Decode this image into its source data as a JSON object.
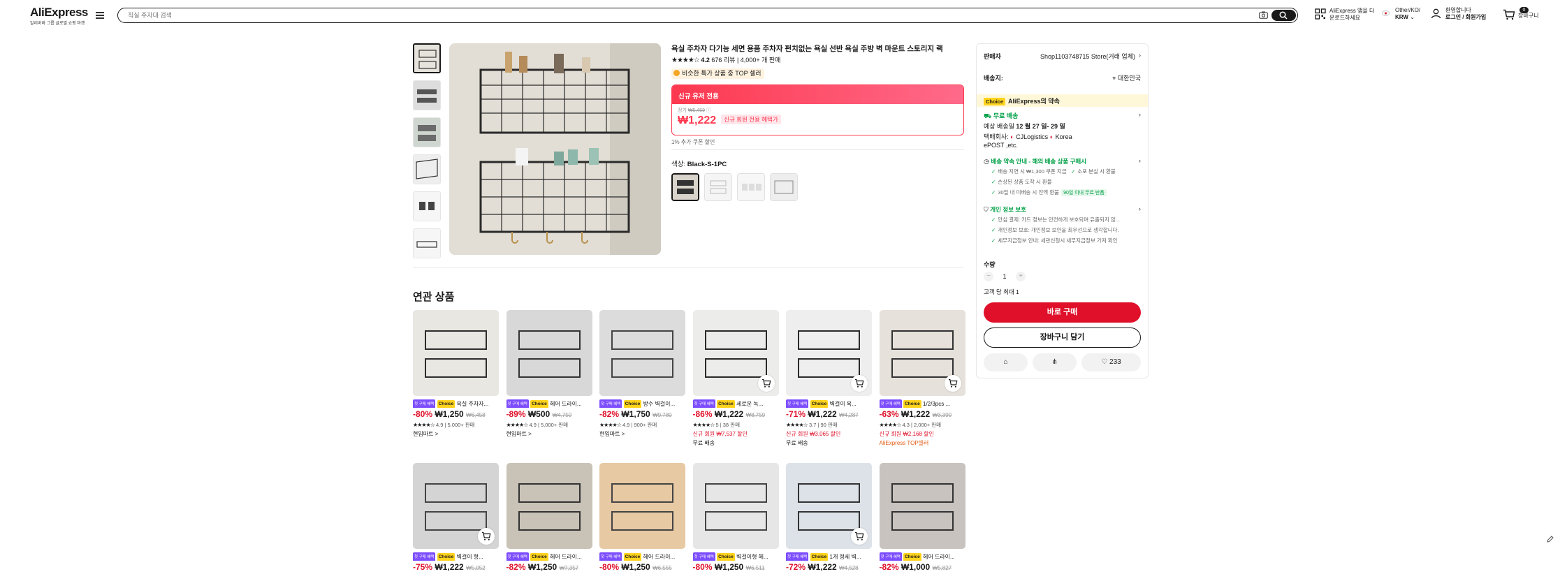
{
  "header": {
    "logo": "AliExpress",
    "logo_sub": "알리바바 그룹 글로벌 쇼핑 마켓",
    "search_placeholder": "직실 주자대 검색",
    "app_line1": "AliExpress 앱을 다",
    "app_line2": "운로드하세요",
    "lang_line1": "Other/KO/",
    "lang_line2": "KRW",
    "user_line1": "환영합니다",
    "user_line2": "로그인 / 회원가입",
    "cart_count": "0",
    "cart_label": "장바구니"
  },
  "product": {
    "title": "욕실 주차자 다기능 세면 용품 주차자 펀치없는 욕실 선반 욕실 주방 벽 마운트 스토리지 랙",
    "rating": "4.2",
    "reviews": "676 리뷰",
    "sold": "4,000+ 개 판매",
    "top_seller": "비슷한 특가 상품 중 TOP 셀러",
    "price_box_title": "신규 유저 전용",
    "orig_label": "정가",
    "orig_price": "₩5,459",
    "price": "₩1,222",
    "price_tag": "신규 회원 전용 혜택가",
    "coupon_note": "1% 추가 쿠폰 할인",
    "color_label": "색상:",
    "color_value": "Black-S-1PC"
  },
  "panel": {
    "seller_label": "판매자",
    "seller_value": "Shop1103748715 Store(거래 업체)",
    "ship_to_label": "배송지:",
    "ship_to_value": "대한민국",
    "choice_badge": "Choice",
    "choice_text": "AliExpress의 약속",
    "free_ship": "무료 배송",
    "delivery_label": "예상 배송일",
    "delivery_value": "12 월 27 일- 29 일",
    "carrier_label": "택배회사:",
    "carrier_value": "CJLogistics",
    "carrier_value2": "Korea",
    "carrier_value3": "ePOST ,etc.",
    "promise_title": "배송 약속 안내 - 해외 배송 상품 구매시",
    "promise_1": "배송 지연 시 ₩1,300 쿠폰 지급",
    "promise_1b": "소포 분실 시 환불",
    "promise_2": "손상된 상품 도착 시 환불",
    "promise_3": "30일 내 미배송 시 전액 환불",
    "promise_3_tag": "90일 이내 무료 반품",
    "privacy_title": "개인 정보 보호",
    "privacy_1": "안심 결제: 카드 정보는 안전하게 보호되며 유출되지 않...",
    "privacy_2": "개인정보 보호: 개인정보 보안을 최우선으로 생각합니다.",
    "privacy_3": "세무지급정보 안내: 세관신청시 세무지급정보 가져 확인",
    "qty_label": "수량",
    "qty_value": "1",
    "per_customer": "고객 당 최대 1",
    "buy_now": "바로 구매",
    "add_cart": "장바구니 담기",
    "wishlist_count": "233"
  },
  "related": {
    "title": "연관 상품",
    "new_tag": "첫 구매 혜택",
    "choice_tag": "Choice",
    "items": [
      {
        "name": "욕실 주차자...",
        "disc": "-80%",
        "price": "₩1,250",
        "orig": "₩6,458",
        "rating": "4.9",
        "meta": "5,000+ 판매",
        "extra": "현임마트 >",
        "extra_class": ""
      },
      {
        "name": "헤어 드라이...",
        "disc": "-89%",
        "price": "₩500",
        "orig": "₩4,750",
        "rating": "4.9",
        "meta": "5,000+ 판매",
        "extra": "현임마트 >",
        "extra_class": ""
      },
      {
        "name": "방수 벽걸이...",
        "disc": "-82%",
        "price": "₩1,750",
        "orig": "₩9,780",
        "rating": "4.9",
        "meta": "900+ 판매",
        "extra": "현임마트 >",
        "extra_class": ""
      },
      {
        "name": "세로운 녹...",
        "disc": "-86%",
        "price": "₩1,222",
        "orig": "₩8,759",
        "rating": "5",
        "meta": "38 판매",
        "extra": "신규 회원 ₩7,537 할인",
        "extra2": "무료 배송",
        "extra_class": "red"
      },
      {
        "name": "벽걸이 욕...",
        "disc": "-71%",
        "price": "₩1,222",
        "orig": "₩4,287",
        "rating": "3.7",
        "meta": "90 판매",
        "extra": "신규 회원 ₩3,065 할인",
        "extra2": "무료 배송",
        "extra_class": "red"
      },
      {
        "name": "1/2/3pcs ...",
        "disc": "-63%",
        "price": "₩1,222",
        "orig": "₩3,390",
        "rating": "4.3",
        "meta": "2,000+ 판매",
        "extra": "신규 회원 ₩2,168 할인",
        "extra2": "AliExpress TOP셀러",
        "extra_class": "red"
      },
      {
        "name": "벽걸이 형...",
        "disc": "-75%",
        "price": "₩1,222",
        "orig": "₩5,052",
        "rating": "",
        "meta": "",
        "extra": "",
        "extra_class": ""
      },
      {
        "name": "헤어 드라이...",
        "disc": "-82%",
        "price": "₩1,250",
        "orig": "₩7,357",
        "rating": "",
        "meta": "",
        "extra": "",
        "extra_class": ""
      },
      {
        "name": "헤어 드라이...",
        "disc": "-80%",
        "price": "₩1,250",
        "orig": "₩6,555",
        "rating": "",
        "meta": "",
        "extra": "",
        "extra_class": ""
      },
      {
        "name": "벽걸이형 헤...",
        "disc": "-80%",
        "price": "₩1,250",
        "orig": "₩6,511",
        "rating": "",
        "meta": "",
        "extra": "",
        "extra_class": ""
      },
      {
        "name": "1개 정세 벽...",
        "disc": "-72%",
        "price": "₩1,222",
        "orig": "₩4,528",
        "rating": "",
        "meta": "",
        "extra": "",
        "extra_class": ""
      },
      {
        "name": "헤어 드라이...",
        "disc": "-82%",
        "price": "₩1,000",
        "orig": "₩5,827",
        "rating": "",
        "meta": "",
        "extra": "",
        "extra_class": ""
      }
    ]
  },
  "colors": {
    "accent": "#fd384f",
    "buy": "#e0102a",
    "choice": "#ffd31d",
    "green": "#00a046"
  }
}
